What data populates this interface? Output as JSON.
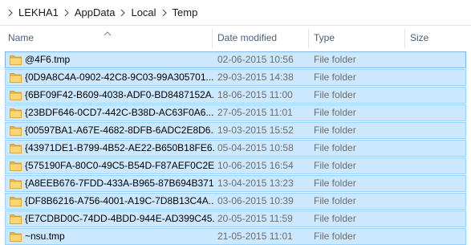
{
  "breadcrumb": {
    "items": [
      {
        "label": "LEKHA1"
      },
      {
        "label": "AppData"
      },
      {
        "label": "Local"
      },
      {
        "label": "Temp"
      }
    ]
  },
  "columns": {
    "name": "Name",
    "date_modified": "Date modified",
    "type": "Type",
    "size": "Size",
    "sorted_column": "name",
    "sort_direction": "ascending"
  },
  "files": [
    {
      "name": "@4F6.tmp",
      "date_modified": "02-06-2015 10:56",
      "type": "File folder",
      "icon": "folder-icon",
      "selected": true
    },
    {
      "name": "{0D9A8C4A-0902-42C8-9C03-99A305701...",
      "date_modified": "29-03-2015 14:38",
      "type": "File folder",
      "icon": "folder-icon",
      "selected": true
    },
    {
      "name": "{6BF09F42-B609-4038-ADF0-BD8487152A...",
      "date_modified": "18-06-2015 11:00",
      "type": "File folder",
      "icon": "folder-icon",
      "selected": true
    },
    {
      "name": "{23BDF646-0CD7-442C-B38D-AC63F0A6...",
      "date_modified": "27-05-2015 11:01",
      "type": "File folder",
      "icon": "folder-icon",
      "selected": true
    },
    {
      "name": "{00597BA1-A67E-4682-8DFB-6ADC2E8D6...",
      "date_modified": "19-03-2015 15:52",
      "type": "File folder",
      "icon": "folder-icon",
      "selected": true
    },
    {
      "name": "{43971DE1-B799-4B52-AE22-B650B18FE6...",
      "date_modified": "05-04-2015 10:58",
      "type": "File folder",
      "icon": "folder-icon",
      "selected": true
    },
    {
      "name": "{575190FA-80C0-49C5-B54D-F87AEF0C2E...",
      "date_modified": "10-06-2015 16:54",
      "type": "File folder",
      "icon": "folder-icon",
      "selected": true
    },
    {
      "name": "{A8EEB676-7FDD-433A-B965-87B694B371...",
      "date_modified": "13-04-2015 13:23",
      "type": "File folder",
      "icon": "folder-icon",
      "selected": true
    },
    {
      "name": "{DF8B6216-A756-4001-A19C-7D8B13C4A...",
      "date_modified": "03-06-2015 10:39",
      "type": "File folder",
      "icon": "folder-icon",
      "selected": true
    },
    {
      "name": "{E7CDBD0C-74DD-4BDD-944E-AD399C45...",
      "date_modified": "20-05-2015 11:59",
      "type": "File folder",
      "icon": "folder-icon",
      "selected": true
    },
    {
      "name": "~nsu.tmp",
      "date_modified": "21-05-2015 11:01",
      "type": "File folder",
      "icon": "folder-icon",
      "selected": true
    }
  ],
  "colors": {
    "selection_fill": "#cce8ff",
    "selection_border": "#99d1ff",
    "header_text": "#4c607a",
    "secondary_text": "#6d6d6d",
    "folder_yellow": "#f5c55a"
  }
}
